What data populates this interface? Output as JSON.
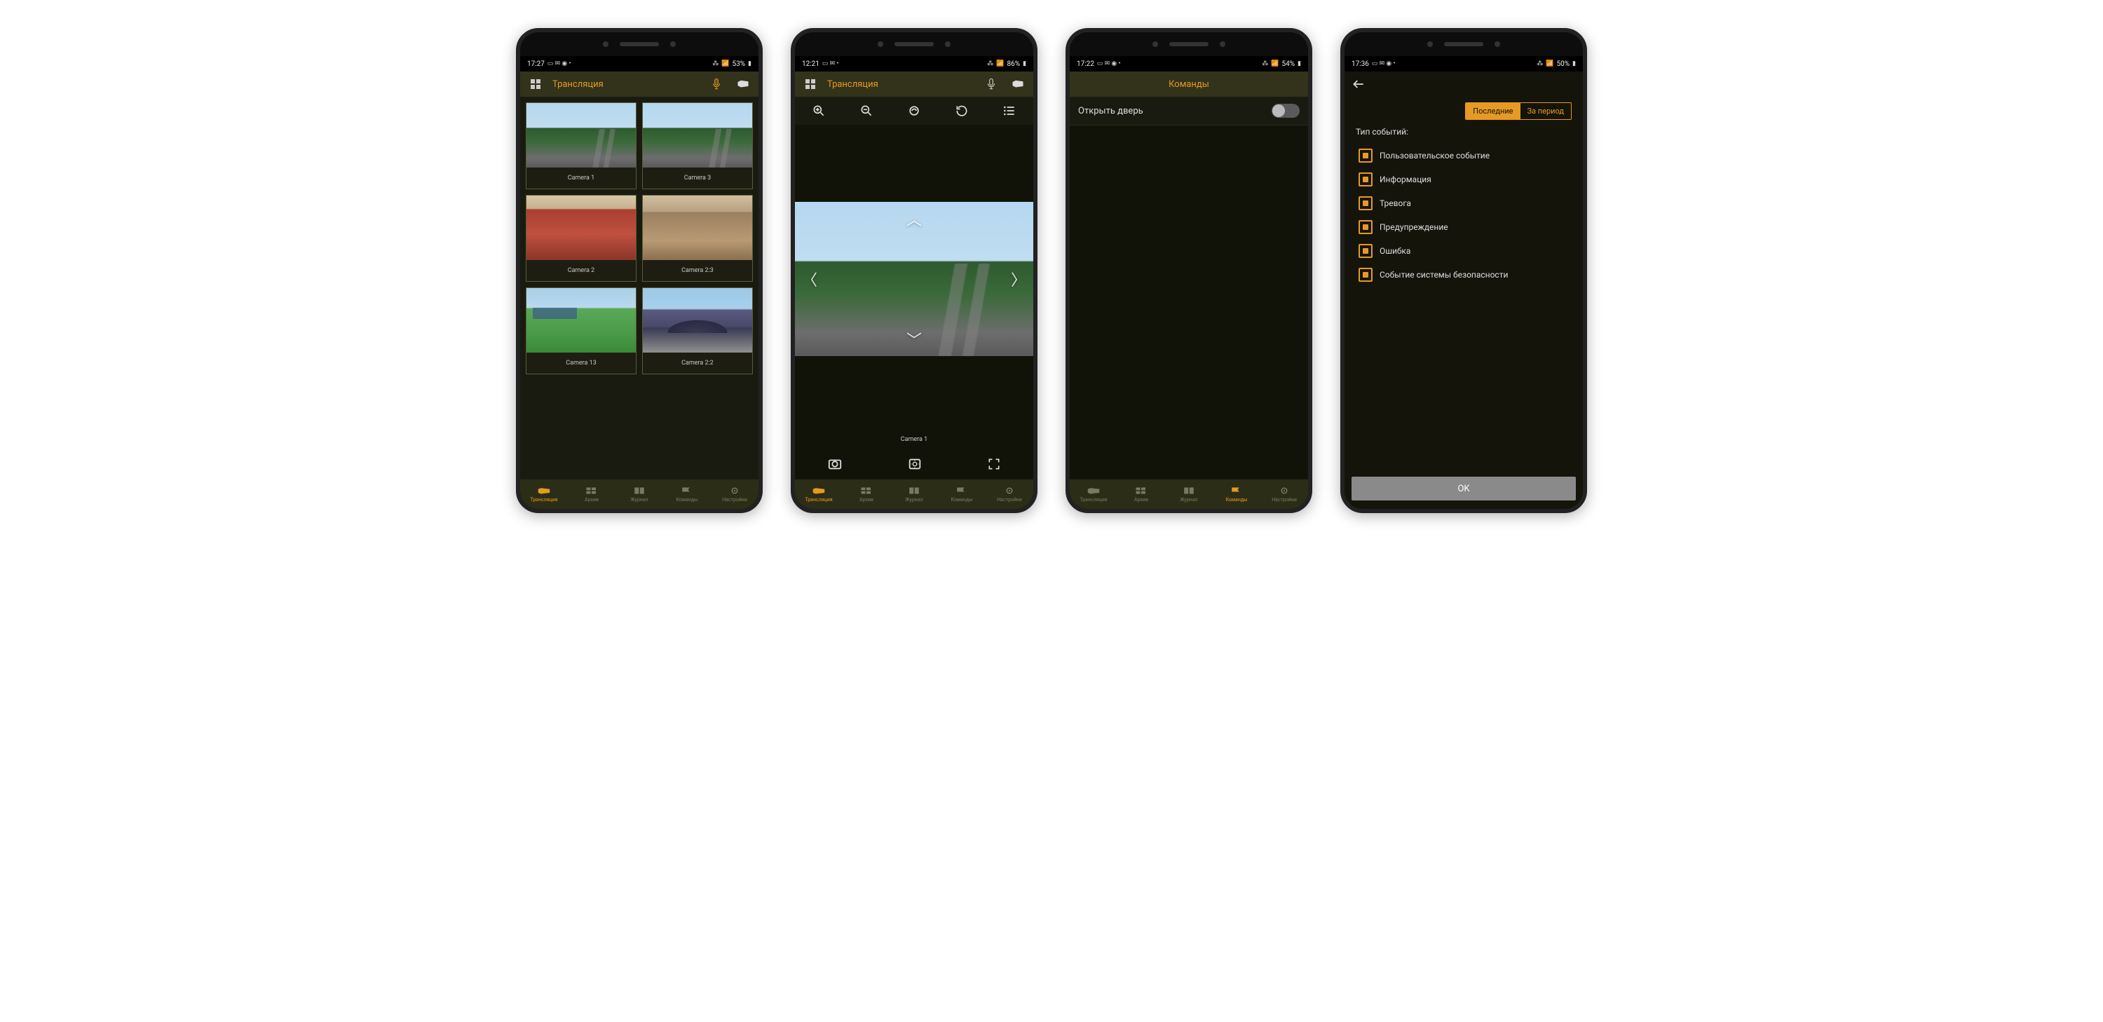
{
  "phones": [
    {
      "status": {
        "time": "17:27",
        "battery": "53%"
      },
      "header": {
        "title": "Трансляция"
      },
      "cams": [
        {
          "label": "Camera 1"
        },
        {
          "label": "Camera 3"
        },
        {
          "label": "Camera 2"
        },
        {
          "label": "Camera 2:3"
        },
        {
          "label": "Camera 13"
        },
        {
          "label": "Camera 2:2"
        }
      ]
    },
    {
      "status": {
        "time": "12:21",
        "battery": "86%"
      },
      "header": {
        "title": "Трансляция"
      },
      "single_cam_label": "Camera 1"
    },
    {
      "status": {
        "time": "17:22",
        "battery": "54%"
      },
      "header": {
        "title": "Команды"
      },
      "command_label": "Открыть дверь"
    },
    {
      "status": {
        "time": "17:36",
        "battery": "50%"
      },
      "segments": {
        "left": "Последние",
        "right": "За период"
      },
      "filter_title": "Тип событий:",
      "event_types": [
        "Пользовательское событие",
        "Информация",
        "Тревога",
        "Предупреждение",
        "Ошибка",
        "Событие системы безопасности"
      ],
      "ok_label": "OK"
    }
  ],
  "tabs": [
    {
      "label": "Трансляция"
    },
    {
      "label": "Архив"
    },
    {
      "label": "Журнал"
    },
    {
      "label": "Команды"
    },
    {
      "label": "Настройки"
    }
  ],
  "colors": {
    "accent": "#e69a23",
    "bg": "#1a1b10",
    "header": "#32331a"
  }
}
